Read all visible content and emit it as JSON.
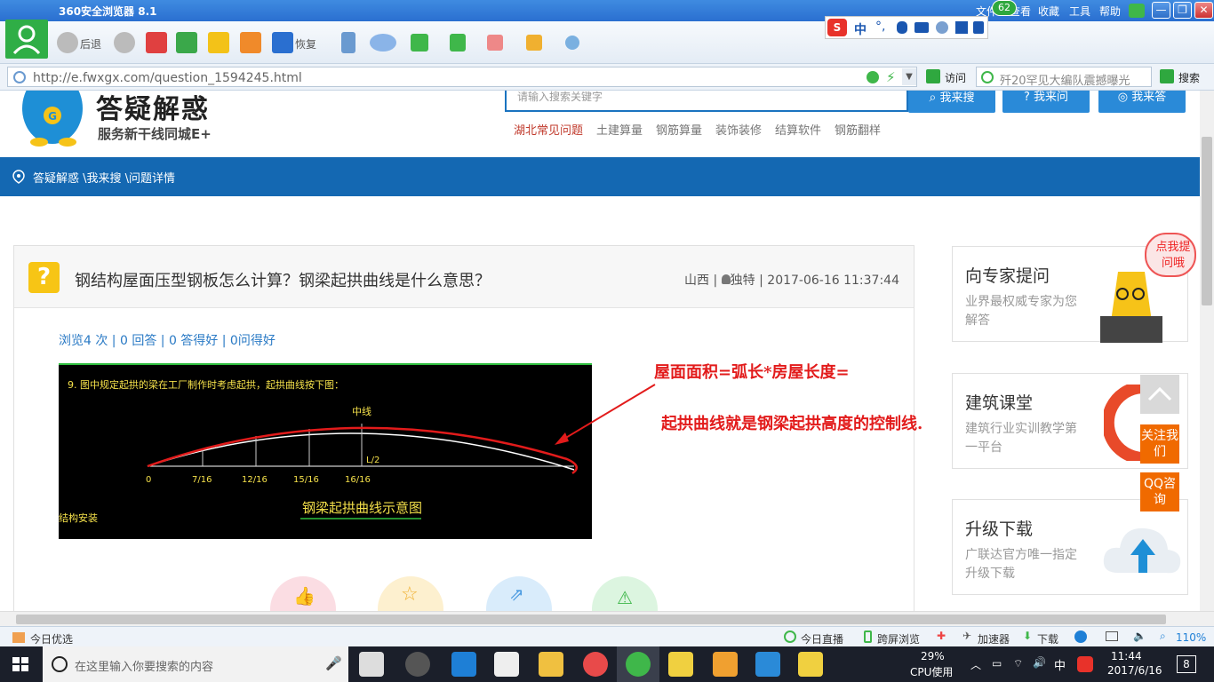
{
  "browser": {
    "title": "360安全浏览器 8.1",
    "menu": [
      "文件",
      "查看",
      "收藏",
      "工具",
      "帮助"
    ],
    "notif_count": "62",
    "toolbar": {
      "back_label": "后退",
      "restore_label": "恢复"
    },
    "ime": {
      "mode": "中"
    },
    "url": "http://e.fwxgx.com/question_1594245.html",
    "go_label": "访问",
    "search_text": "歼20罕见大编队震撼曝光",
    "search_label": "搜索"
  },
  "site": {
    "logo_title": "答疑解惑",
    "logo_subtitle": "服务新干线同城E+",
    "search_placeholder": "请输入搜索关键字",
    "buttons": {
      "search": "我来搜",
      "ask": "我来问",
      "answer": "我来答"
    },
    "hot_links": [
      "湖北常见问题",
      "土建算量",
      "钢筋算量",
      "装饰装修",
      "结算软件",
      "钢筋翻样"
    ],
    "breadcrumb": "答疑解惑 \\我来搜 \\问题详情"
  },
  "question": {
    "title": "钢结构屋面压型钢板怎么计算？钢梁起拱曲线是什么意思？",
    "region": "山西",
    "author": "独特",
    "datetime": "2017-06-16 11:37:44",
    "stats": "浏览4 次 | 0 回答 | 0 答得好 | 0问得好",
    "image": {
      "note": "9. 图中规定起拱的梁在工厂制作时考虑起拱，起拱曲线按下图：",
      "center_label": "中线",
      "half_label": "L/2",
      "ticks": [
        "0",
        "7/16",
        "12/16",
        "15/16",
        "16/16"
      ],
      "caption": "钢梁起拱曲线示意图",
      "side_text": "结构安装"
    },
    "annotation_line1": "屋面面积=弧长*房屋长度=",
    "annotation_line2": "起拱曲线就是钢梁起拱高度的控制线."
  },
  "sidebar": {
    "cards": [
      {
        "title": "向专家提问",
        "sub": "业界最权威专家为您解答",
        "bubble": "点我提问哦"
      },
      {
        "title": "建筑课堂",
        "sub": "建筑行业实训教学第一平台"
      },
      {
        "title": "升级下载",
        "sub": "广联达官方唯一指定升级下载"
      }
    ],
    "follow_label": "关注我们",
    "qq_label": "QQ咨询"
  },
  "statusbar": {
    "left": "今日优选",
    "items": [
      "今日直播",
      "跨屏浏览",
      "加速器",
      "下载"
    ],
    "zoom": "110%"
  },
  "taskbar": {
    "search_placeholder": "在这里输入你要搜索的内容",
    "cpu_pct": "29%",
    "cpu_label": "CPU使用",
    "ime": "中",
    "time": "11:44",
    "date": "2017/6/16",
    "notif": "8"
  }
}
